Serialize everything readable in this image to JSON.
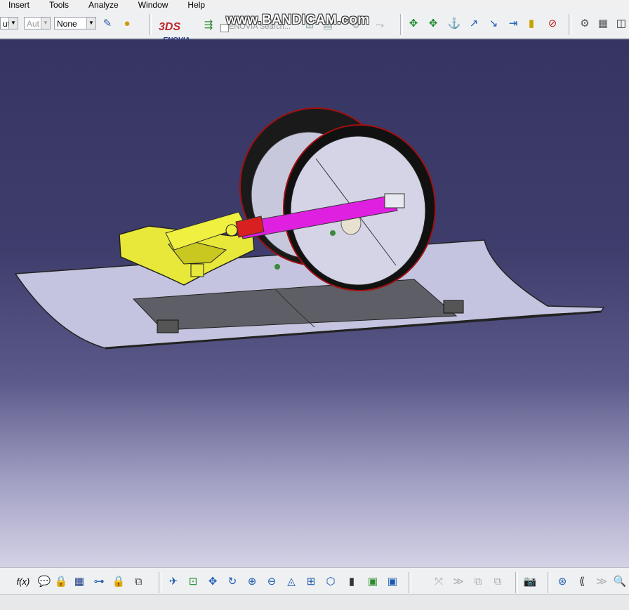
{
  "menu": {
    "items": [
      {
        "label": "Insert"
      },
      {
        "label": "Tools"
      },
      {
        "label": "Analyze"
      },
      {
        "label": "Window"
      },
      {
        "label": "Help"
      }
    ]
  },
  "toolbar": {
    "combo_1": "ut",
    "combo_2": "Aut",
    "combo_3": "None",
    "enovia_logo_text": "ENOVIA",
    "enovia_search": "ENOVIA Search...",
    "watermark": "www.BANDICAM.com"
  },
  "icons": {
    "top": [
      "paint-brush-icon",
      "material-sphere-icon",
      "enovia-logo-icon",
      "formula-arrow-icon",
      "search-binoculars-icon",
      "catalog-icon",
      "disabled-icon-1",
      "disabled-icon-2",
      "manipulate-icon",
      "snap-icon",
      "anchor-icon",
      "pointer-icon",
      "arrow-icon",
      "spacing-icon",
      "ruler-icon",
      "clash-icon",
      "clash-check-icon",
      "parts-icon",
      "paste-special-icon",
      "window-icon"
    ],
    "bottom": [
      "formula-icon",
      "comment-icon",
      "lock-disabled-icon",
      "table-icon",
      "hierarchy-icon",
      "lock-icon",
      "macro-icon",
      "fly-mode-icon",
      "fit-all-icon",
      "pan-icon",
      "rotate-icon",
      "zoom-in-icon",
      "zoom-out-icon",
      "normal-view-icon",
      "views-cube-icon",
      "iso-view-icon",
      "render-style-icon",
      "hide-show-icon",
      "swap-visible-icon",
      "disabled-icon-3",
      "disabled-icon-4",
      "disabled-icon-5",
      "disabled-icon-6",
      "camera-icon",
      "compass-icon",
      "first-frame-icon",
      "next-frame-icon",
      "zoom-tool-icon"
    ]
  },
  "colors": {
    "viewport_top": "#363562",
    "viewport_bottom": "#d4d2e6",
    "bracket": "#e8e83a",
    "actuator_rod": "#e020e0",
    "actuator_joint": "#e02020",
    "wheel_face": "#d8d8e8",
    "ski": "#c8c8e0"
  }
}
